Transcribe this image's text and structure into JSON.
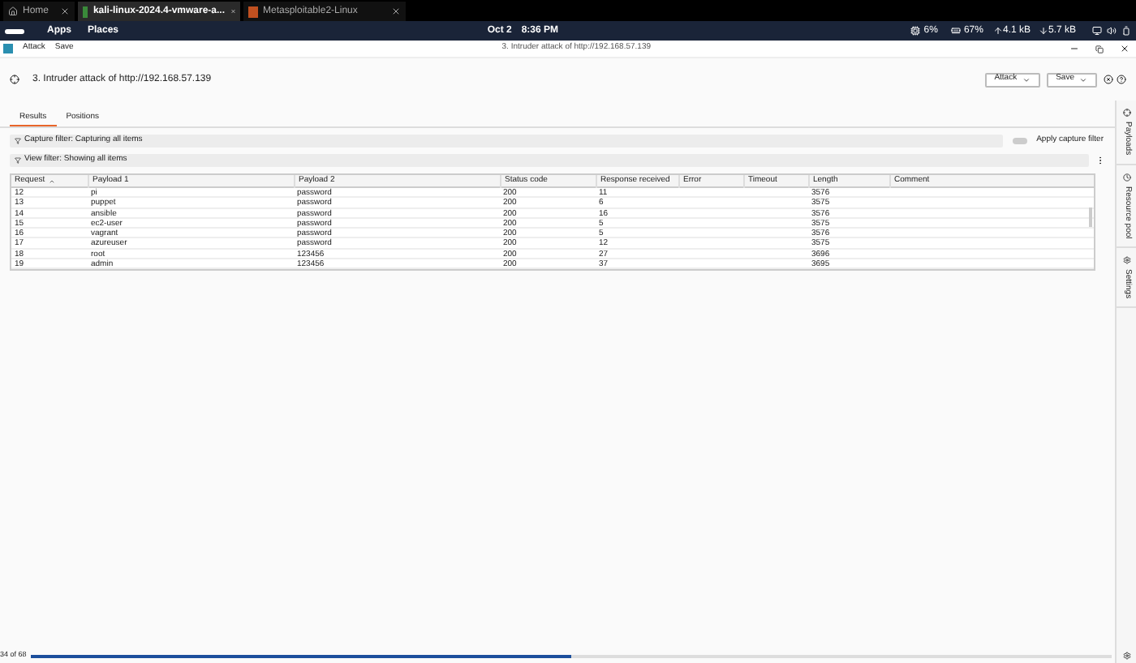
{
  "vm_tabs": [
    {
      "label": "Home",
      "selected": false
    },
    {
      "label": "kali-linux-2024.4-vmware-a...",
      "selected": true
    },
    {
      "label": "Metasploitable2-Linux",
      "selected": false
    }
  ],
  "top_panel": {
    "menus": [
      "Apps",
      "Places"
    ],
    "date": "Oct 2",
    "time": "8:36 PM",
    "cpu": "6%",
    "memory": "67%",
    "upload": "4.1 kB",
    "download": "5.7 kB"
  },
  "app_menu": [
    "Attack",
    "Save"
  ],
  "window": {
    "title": "3. Intruder attack of http://192.168.57.139"
  },
  "heading": "3. Intruder attack of http://192.168.57.139",
  "header_buttons": [
    "Attack",
    "Save"
  ],
  "tabs": [
    {
      "label": "Results",
      "selected": true
    },
    {
      "label": "Positions",
      "selected": false
    }
  ],
  "capture_filter": {
    "label": "Capture filter: Capturing all items",
    "toggle_label": "Apply capture filter",
    "on": false
  },
  "view_filter": "View filter: Showing all items",
  "table": {
    "columns": [
      "Request",
      "Payload 1",
      "Payload 2",
      "Status code",
      "Response received",
      "Error",
      "Timeout",
      "Length",
      "Comment"
    ],
    "rows": [
      {
        "request": "12",
        "payload_1": "pi",
        "payload_2": "password",
        "status_code": "200",
        "response_received": "11",
        "length": "3576"
      },
      {
        "request": "13",
        "payload_1": "puppet",
        "payload_2": "password",
        "status_code": "200",
        "response_received": "6",
        "length": "3575"
      },
      {
        "request": "14",
        "payload_1": "ansible",
        "payload_2": "password",
        "status_code": "200",
        "response_received": "16",
        "length": "3576"
      },
      {
        "request": "15",
        "payload_1": "ec2-user",
        "payload_2": "password",
        "status_code": "200",
        "response_received": "5",
        "length": "3575"
      },
      {
        "request": "16",
        "payload_1": "vagrant",
        "payload_2": "password",
        "status_code": "200",
        "response_received": "5",
        "length": "3576"
      },
      {
        "request": "17",
        "payload_1": "azureuser",
        "payload_2": "password",
        "status_code": "200",
        "response_received": "12",
        "length": "3575"
      },
      {
        "request": "18",
        "payload_1": "root",
        "payload_2": "123456",
        "status_code": "200",
        "response_received": "27",
        "length": "3696"
      },
      {
        "request": "19",
        "payload_1": "admin",
        "payload_2": "123456",
        "status_code": "200",
        "response_received": "37",
        "length": "3695"
      }
    ]
  },
  "side_tabs": [
    "Payloads",
    "Resource pool",
    "Settings"
  ],
  "progress": {
    "text": "34 of 68",
    "level": 0.5
  }
}
